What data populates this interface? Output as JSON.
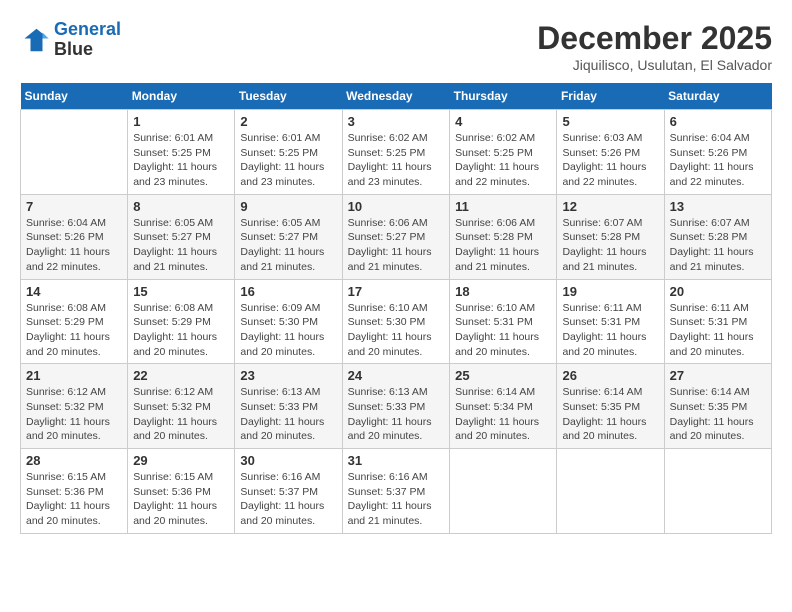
{
  "header": {
    "logo_line1": "General",
    "logo_line2": "Blue",
    "month": "December 2025",
    "location": "Jiquilisco, Usulutan, El Salvador"
  },
  "days_of_week": [
    "Sunday",
    "Monday",
    "Tuesday",
    "Wednesday",
    "Thursday",
    "Friday",
    "Saturday"
  ],
  "weeks": [
    [
      {
        "day": "",
        "info": ""
      },
      {
        "day": "1",
        "info": "Sunrise: 6:01 AM\nSunset: 5:25 PM\nDaylight: 11 hours\nand 23 minutes."
      },
      {
        "day": "2",
        "info": "Sunrise: 6:01 AM\nSunset: 5:25 PM\nDaylight: 11 hours\nand 23 minutes."
      },
      {
        "day": "3",
        "info": "Sunrise: 6:02 AM\nSunset: 5:25 PM\nDaylight: 11 hours\nand 23 minutes."
      },
      {
        "day": "4",
        "info": "Sunrise: 6:02 AM\nSunset: 5:25 PM\nDaylight: 11 hours\nand 22 minutes."
      },
      {
        "day": "5",
        "info": "Sunrise: 6:03 AM\nSunset: 5:26 PM\nDaylight: 11 hours\nand 22 minutes."
      },
      {
        "day": "6",
        "info": "Sunrise: 6:04 AM\nSunset: 5:26 PM\nDaylight: 11 hours\nand 22 minutes."
      }
    ],
    [
      {
        "day": "7",
        "info": "Sunrise: 6:04 AM\nSunset: 5:26 PM\nDaylight: 11 hours\nand 22 minutes."
      },
      {
        "day": "8",
        "info": "Sunrise: 6:05 AM\nSunset: 5:27 PM\nDaylight: 11 hours\nand 21 minutes."
      },
      {
        "day": "9",
        "info": "Sunrise: 6:05 AM\nSunset: 5:27 PM\nDaylight: 11 hours\nand 21 minutes."
      },
      {
        "day": "10",
        "info": "Sunrise: 6:06 AM\nSunset: 5:27 PM\nDaylight: 11 hours\nand 21 minutes."
      },
      {
        "day": "11",
        "info": "Sunrise: 6:06 AM\nSunset: 5:28 PM\nDaylight: 11 hours\nand 21 minutes."
      },
      {
        "day": "12",
        "info": "Sunrise: 6:07 AM\nSunset: 5:28 PM\nDaylight: 11 hours\nand 21 minutes."
      },
      {
        "day": "13",
        "info": "Sunrise: 6:07 AM\nSunset: 5:28 PM\nDaylight: 11 hours\nand 21 minutes."
      }
    ],
    [
      {
        "day": "14",
        "info": "Sunrise: 6:08 AM\nSunset: 5:29 PM\nDaylight: 11 hours\nand 20 minutes."
      },
      {
        "day": "15",
        "info": "Sunrise: 6:08 AM\nSunset: 5:29 PM\nDaylight: 11 hours\nand 20 minutes."
      },
      {
        "day": "16",
        "info": "Sunrise: 6:09 AM\nSunset: 5:30 PM\nDaylight: 11 hours\nand 20 minutes."
      },
      {
        "day": "17",
        "info": "Sunrise: 6:10 AM\nSunset: 5:30 PM\nDaylight: 11 hours\nand 20 minutes."
      },
      {
        "day": "18",
        "info": "Sunrise: 6:10 AM\nSunset: 5:31 PM\nDaylight: 11 hours\nand 20 minutes."
      },
      {
        "day": "19",
        "info": "Sunrise: 6:11 AM\nSunset: 5:31 PM\nDaylight: 11 hours\nand 20 minutes."
      },
      {
        "day": "20",
        "info": "Sunrise: 6:11 AM\nSunset: 5:31 PM\nDaylight: 11 hours\nand 20 minutes."
      }
    ],
    [
      {
        "day": "21",
        "info": "Sunrise: 6:12 AM\nSunset: 5:32 PM\nDaylight: 11 hours\nand 20 minutes."
      },
      {
        "day": "22",
        "info": "Sunrise: 6:12 AM\nSunset: 5:32 PM\nDaylight: 11 hours\nand 20 minutes."
      },
      {
        "day": "23",
        "info": "Sunrise: 6:13 AM\nSunset: 5:33 PM\nDaylight: 11 hours\nand 20 minutes."
      },
      {
        "day": "24",
        "info": "Sunrise: 6:13 AM\nSunset: 5:33 PM\nDaylight: 11 hours\nand 20 minutes."
      },
      {
        "day": "25",
        "info": "Sunrise: 6:14 AM\nSunset: 5:34 PM\nDaylight: 11 hours\nand 20 minutes."
      },
      {
        "day": "26",
        "info": "Sunrise: 6:14 AM\nSunset: 5:35 PM\nDaylight: 11 hours\nand 20 minutes."
      },
      {
        "day": "27",
        "info": "Sunrise: 6:14 AM\nSunset: 5:35 PM\nDaylight: 11 hours\nand 20 minutes."
      }
    ],
    [
      {
        "day": "28",
        "info": "Sunrise: 6:15 AM\nSunset: 5:36 PM\nDaylight: 11 hours\nand 20 minutes."
      },
      {
        "day": "29",
        "info": "Sunrise: 6:15 AM\nSunset: 5:36 PM\nDaylight: 11 hours\nand 20 minutes."
      },
      {
        "day": "30",
        "info": "Sunrise: 6:16 AM\nSunset: 5:37 PM\nDaylight: 11 hours\nand 20 minutes."
      },
      {
        "day": "31",
        "info": "Sunrise: 6:16 AM\nSunset: 5:37 PM\nDaylight: 11 hours\nand 21 minutes."
      },
      {
        "day": "",
        "info": ""
      },
      {
        "day": "",
        "info": ""
      },
      {
        "day": "",
        "info": ""
      }
    ]
  ],
  "colors": {
    "header_bg": "#1a6bb5",
    "header_text": "#ffffff",
    "border": "#cccccc"
  }
}
